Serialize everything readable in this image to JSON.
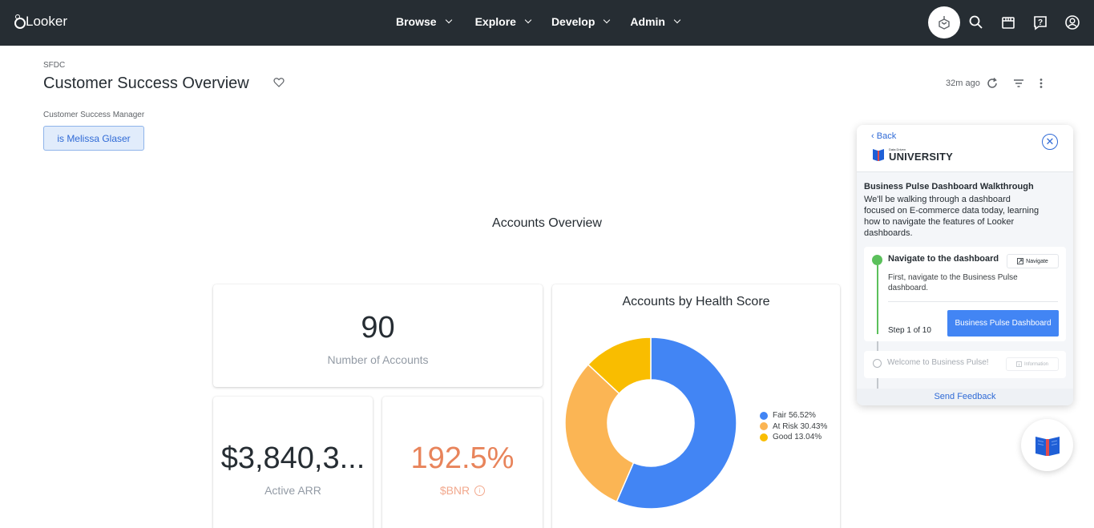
{
  "app": {
    "logo_text": "Looker"
  },
  "nav": {
    "browse": "Browse",
    "explore": "Explore",
    "develop": "Develop",
    "admin": "Admin"
  },
  "top_icons": [
    "lab-icon",
    "search-icon",
    "marketplace-icon",
    "help-icon",
    "account-icon"
  ],
  "header": {
    "breadcrumb": "SFDC",
    "title": "Customer Success Overview",
    "updated": "32m ago"
  },
  "filter": {
    "label": "Customer Success Manager",
    "value": "is Melissa Glaser"
  },
  "section_title": "Accounts Overview",
  "tiles": {
    "accounts": {
      "value": "90",
      "label": "Number of Accounts"
    },
    "arr": {
      "value": "$3,840,3...",
      "label": "Active ARR"
    },
    "bnr": {
      "value": "192.5%",
      "label": "$BNR"
    }
  },
  "chart_data": {
    "type": "pie",
    "title": "Accounts by Health Score",
    "categories": [
      "Fair",
      "At Risk",
      "Good"
    ],
    "values": [
      56.52,
      30.43,
      13.04
    ],
    "legend_labels": [
      "Fair 56.52%",
      "At Risk 30.43%",
      "Good 13.04%"
    ],
    "colors": [
      "#4285f4",
      "#fbb554",
      "#f9bd00"
    ],
    "donut": true,
    "legend_position": "right"
  },
  "walkthrough": {
    "back": "Back",
    "logo_small": "Data Driven",
    "logo_big": "UNIVERSITY",
    "title": "Business Pulse Dashboard Walkthrough",
    "description": "We'll be walking through a dashboard focused on E-commerce data today, learning how to navigate the features of Looker dashboards.",
    "step": {
      "name": "Navigate to the dashboard",
      "tag": "Navigate",
      "description": "First, navigate to the Business Pulse dashboard.",
      "count": "Step 1 of 10",
      "button": "Business Pulse Dashboard"
    },
    "next_step": {
      "name": "Welcome to Business Pulse!",
      "tag": "Information"
    },
    "feedback": "Send Feedback"
  },
  "colors": {
    "topbar": "#262d33",
    "accent": "#2f6ad6",
    "button": "#4285f4",
    "step_done": "#5bc05b",
    "bnr": "#e8845b"
  }
}
